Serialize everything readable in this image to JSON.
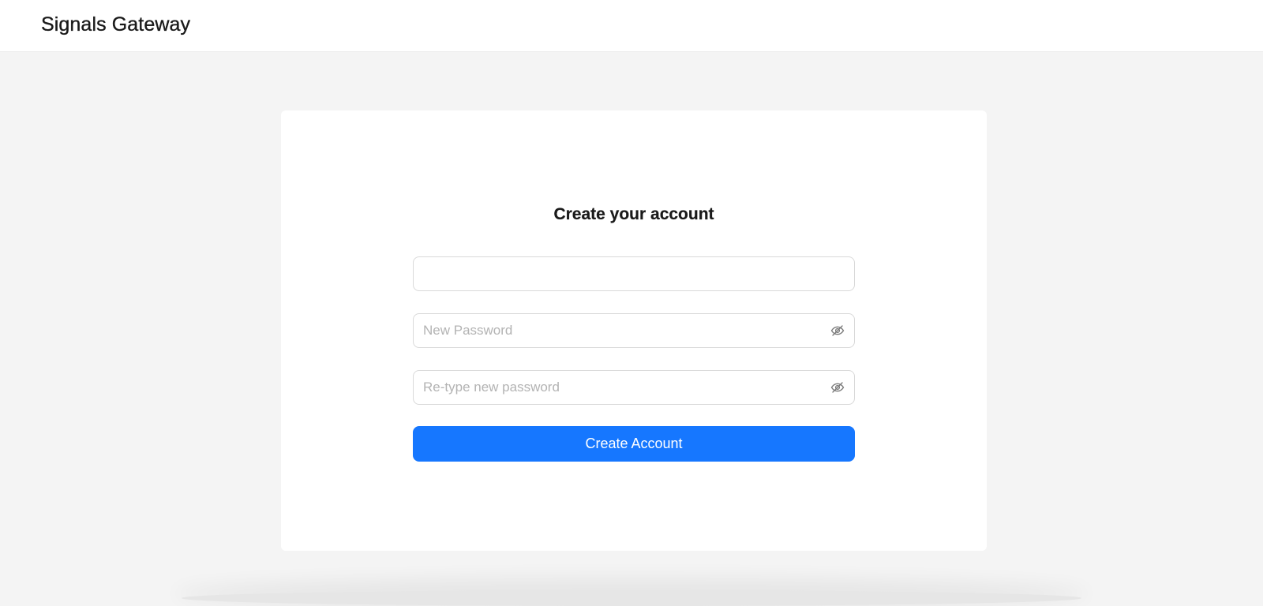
{
  "header": {
    "brand": "Signals Gateway"
  },
  "form": {
    "title": "Create your account",
    "email": {
      "value": "",
      "placeholder": ""
    },
    "new_password": {
      "value": "",
      "placeholder": "New Password",
      "toggle_icon": "eye-off-icon"
    },
    "retype_password": {
      "value": "",
      "placeholder": "Re-type new password",
      "toggle_icon": "eye-off-icon"
    },
    "submit_label": "Create Account"
  },
  "colors": {
    "accent": "#1677ff",
    "page_background": "#f4f4f4",
    "card_background": "#ffffff"
  }
}
